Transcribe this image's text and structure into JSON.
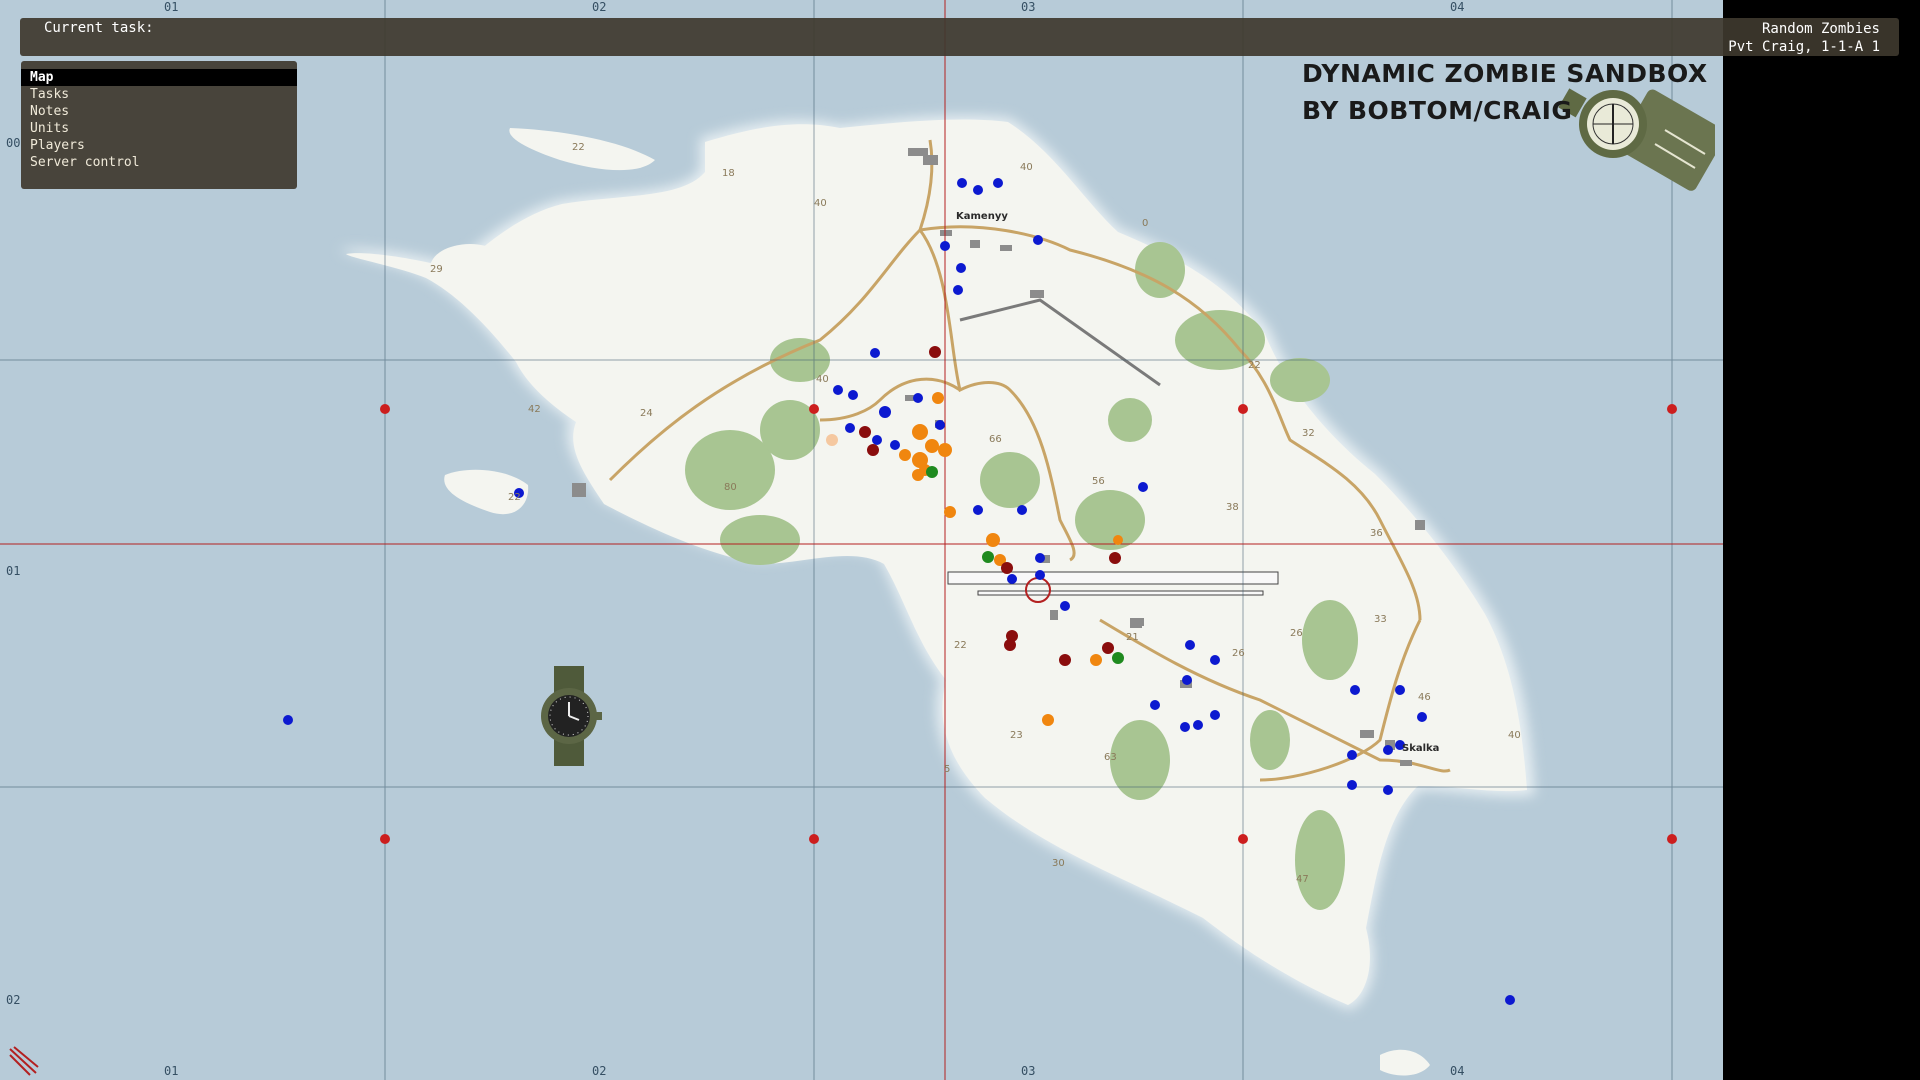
{
  "app": {
    "title": "Dynamic Zombie Sandbox map"
  },
  "top_bar": {
    "current_task_label": "Current task:",
    "mission_name": "Random Zombies",
    "player_info": "Pvt Craig, 1-1-A 1"
  },
  "menu": {
    "items": [
      {
        "label": "Map",
        "selected": true
      },
      {
        "label": "Tasks",
        "selected": false
      },
      {
        "label": "Notes",
        "selected": false
      },
      {
        "label": "Units",
        "selected": false
      },
      {
        "label": "Players",
        "selected": false
      },
      {
        "label": "Server control",
        "selected": false
      }
    ]
  },
  "map_title": {
    "line1": "DYNAMIC ZOMBIE SANDBOX",
    "line2": "BY BOBTOM/CRAIG"
  },
  "grid_labels": {
    "top": [
      "01",
      "02",
      "03",
      "04"
    ],
    "bottom": [
      "01",
      "02",
      "03",
      "04"
    ],
    "left": [
      "00",
      "01",
      "02"
    ]
  },
  "place_names": [
    "Kamenyy",
    "Skalka"
  ],
  "elevation_labels": [
    "22",
    "18",
    "40",
    "40",
    "29",
    "42",
    "24",
    "40",
    "80",
    "66",
    "22",
    "56",
    "38",
    "36",
    "32",
    "0",
    "22",
    "33",
    "26",
    "26",
    "21",
    "22",
    "23",
    "63",
    "46",
    "40",
    "30",
    "47",
    "5"
  ],
  "marker_colors": {
    "blue": "#0c19d0",
    "orange": "#f0860f",
    "dark_red": "#8a0d0d",
    "green": "#1f8a1f",
    "grid_red_dot": "#cc1e1e"
  },
  "icons": {
    "compass": "compass-icon",
    "watch": "wristwatch-icon",
    "player_cursor": "player-position-icon"
  }
}
